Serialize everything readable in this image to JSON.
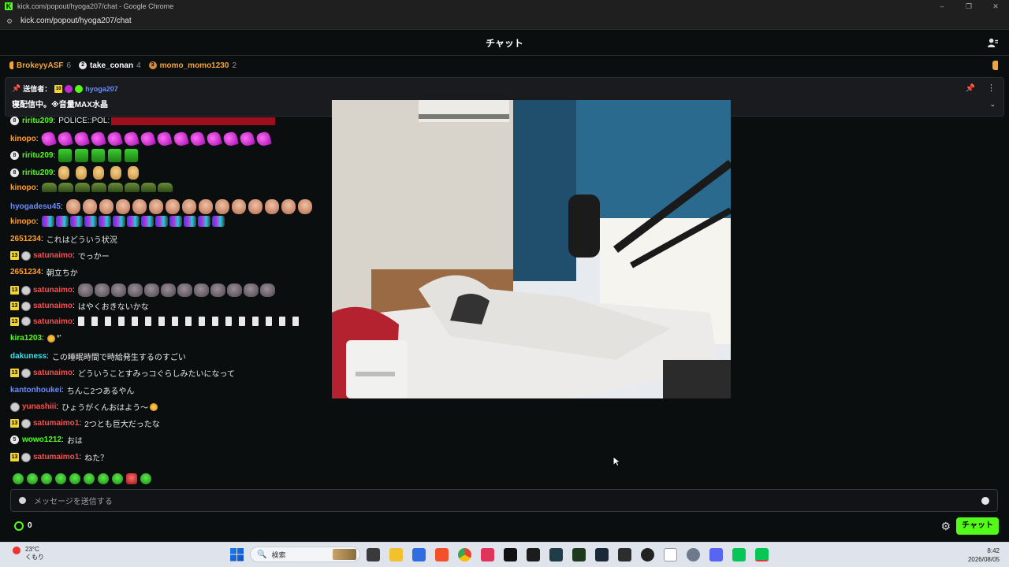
{
  "window": {
    "title": "kick.com/popout/hyoga207/chat - Google Chrome",
    "url": "kick.com/popout/hyoga207/chat",
    "controls": [
      "–",
      "❐",
      "✕"
    ]
  },
  "header": {
    "title": "チャット"
  },
  "leaderboard": [
    {
      "name": "BrokeyyASF",
      "count": "6",
      "color": "#f2a33a",
      "rank": ""
    },
    {
      "name": "take_conan",
      "count": "4",
      "color": "#ffffff",
      "rank": "2"
    },
    {
      "name": "momo_momo1230",
      "count": "2",
      "color": "#f2a33a",
      "rank": "3"
    }
  ],
  "pinned": {
    "label": "送信者：",
    "sub_badge": "10",
    "user": "hyoga207",
    "message": "寝配信中。※音量MAX水晶"
  },
  "messages": [
    {
      "user": "riritu209",
      "color": "#53fc18",
      "badge": "circle",
      "badge_text": "8",
      "text": "POLICE::POL:",
      "emotes": "red"
    },
    {
      "user": "kinopo",
      "color": "#ff9d2e",
      "badge": "",
      "text": "",
      "emotes": "heart"
    },
    {
      "user": "riritu209",
      "color": "#53fc18",
      "badge": "circle",
      "badge_text": "8",
      "text": "",
      "emotes": "green"
    },
    {
      "user": "riritu209",
      "color": "#53fc18",
      "badge": "circle",
      "badge_text": "8",
      "text": "",
      "emotes": "ok"
    },
    {
      "user": "kinopo",
      "color": "#ff9d2e",
      "badge": "",
      "text": "",
      "emotes": "croc"
    },
    {
      "user": "hyogadesu45",
      "color": "#6a8cff",
      "badge": "",
      "text": "",
      "emotes": "face"
    },
    {
      "user": "kinopo",
      "color": "#ff9d2e",
      "badge": "",
      "text": "",
      "emotes": "stripe"
    },
    {
      "user": "2651234",
      "color": "#ff9d2e",
      "badge": "",
      "text": "これはどういう状況",
      "emotes": ""
    },
    {
      "user": "satunaimo",
      "color": "#ff4d4d",
      "badge": "sub",
      "badge_text": "13",
      "text": "でっかー",
      "emotes": ""
    },
    {
      "user": "2651234",
      "color": "#ff9d2e",
      "badge": "",
      "text": "朝立ちか",
      "emotes": ""
    },
    {
      "user": "satunaimo",
      "color": "#ff4d4d",
      "badge": "sub",
      "badge_text": "13",
      "text": "",
      "emotes": "rock"
    },
    {
      "user": "satunaimo",
      "color": "#ff4d4d",
      "badge": "sub",
      "badge_text": "13",
      "text": "はやくおきないかな",
      "emotes": ""
    },
    {
      "user": "satunaimo",
      "color": "#ff4d4d",
      "badge": "sub",
      "badge_text": "13",
      "text": "",
      "emotes": "bar"
    },
    {
      "user": "kira1203",
      "color": "#53fc18",
      "badge": "",
      "text": "*'",
      "emotes": "sun"
    },
    {
      "user": "dakuness",
      "color": "#2ee6f2",
      "badge": "",
      "text": "この睡眠時間で時給発生するのすごい",
      "emotes": ""
    },
    {
      "user": "satunaimo",
      "color": "#ff4d4d",
      "badge": "sub",
      "badge_text": "13",
      "text": "どういうことすみっコぐらしみたいになって",
      "emotes": ""
    },
    {
      "user": "kantonhoukei",
      "color": "#6a8cff",
      "badge": "",
      "text": "ちんこ2つあるやん",
      "emotes": ""
    },
    {
      "user": "yunashiii",
      "color": "#ff4d4d",
      "badge": "avonly",
      "text": "ひょうがくんおはよう～",
      "emotes": "sun"
    },
    {
      "user": "satumaimo1",
      "color": "#ff4d4d",
      "badge": "sub",
      "badge_text": "13",
      "text": "2つとも巨大だったな",
      "emotes": ""
    },
    {
      "user": "wowo1212",
      "color": "#53fc18",
      "badge": "circle",
      "badge_text": "5",
      "text": "おは",
      "emotes": ""
    },
    {
      "user": "satumaimo1",
      "color": "#ff4d4d",
      "badge": "sub",
      "badge_text": "13",
      "text": "ねた？",
      "emotes": ""
    }
  ],
  "input": {
    "placeholder": "メッセージを送信する"
  },
  "footer": {
    "points": "0",
    "send_label": "チャット"
  },
  "taskbar": {
    "temp": "23°C",
    "weather": "くもり",
    "search": "検索",
    "time": "8:42",
    "date": "2026/08/05"
  }
}
